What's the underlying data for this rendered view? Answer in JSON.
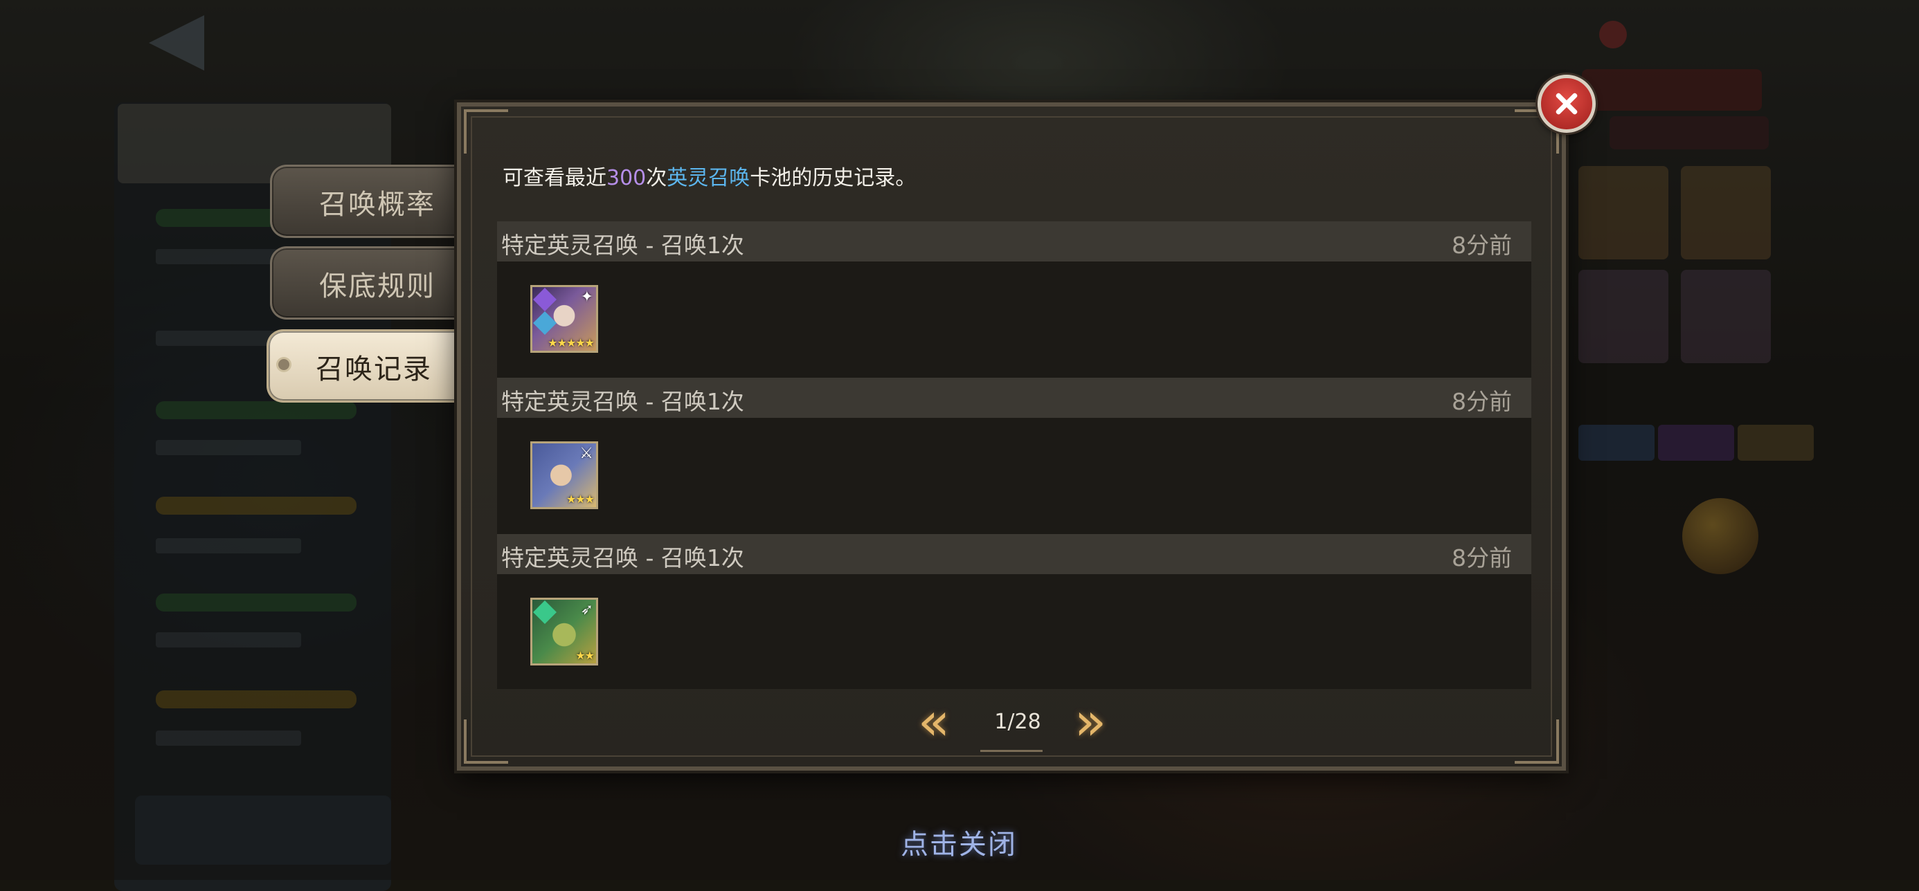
{
  "tabs": [
    {
      "label": "召唤概率",
      "active": false
    },
    {
      "label": "保底规则",
      "active": false
    },
    {
      "label": "召唤记录",
      "active": true
    }
  ],
  "dialog": {
    "description": {
      "prefix": "可查看最近",
      "count": "300",
      "mid": "次",
      "pool": "英灵召唤",
      "suffix": "卡池的历史记录。"
    },
    "records": [
      {
        "title": "特定英灵召唤 - 召唤1次",
        "time": "8分前",
        "hero_icon": "hero-portrait-icon",
        "stars": "★★★★★"
      },
      {
        "title": "特定英灵召唤 - 召唤1次",
        "time": "8分前",
        "hero_icon": "hero-portrait-icon",
        "stars": "★★★"
      },
      {
        "title": "特定英灵召唤 - 召唤1次",
        "time": "8分前",
        "hero_icon": "hero-portrait-icon",
        "stars": "★★"
      }
    ],
    "pagination": {
      "text": "1/28",
      "prev_icon": "double-chevron-left-icon",
      "next_icon": "double-chevron-right-icon"
    }
  },
  "tap_to_close": "点击关闭",
  "colors": {
    "count_highlight": "#b58ee8",
    "pool_highlight": "#5cb6ee",
    "star": "#ffd84a",
    "close_red": "#e14a43"
  }
}
